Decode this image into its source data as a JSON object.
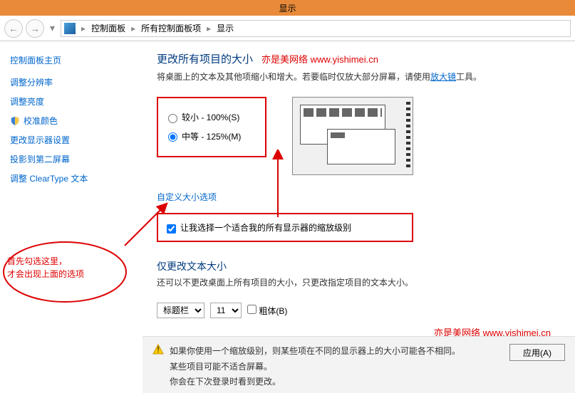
{
  "window": {
    "title": "显示"
  },
  "breadcrumb": {
    "items": [
      "控制面板",
      "所有控制面板项",
      "显示"
    ]
  },
  "sidebar": {
    "title": "控制面板主页",
    "links": [
      "调整分辨率",
      "调整亮度",
      "校准颜色",
      "更改显示器设置",
      "投影到第二屏幕",
      "调整 ClearType 文本"
    ]
  },
  "content": {
    "heading": "更改所有项目的大小",
    "watermark": "亦是美网络 www.yishimei.cn",
    "desc_pre": "将桌面上的文本及其他项缩小和增大。若要临时仅放大部分屏幕，请使用",
    "desc_link": "放大镜",
    "desc_post": "工具。",
    "radio": {
      "opt1": "较小 - 100%(S)",
      "opt2": "中等 - 125%(M)"
    },
    "custom_link": "自定义大小选项",
    "checkbox_label": "让我选择一个适合我的所有显示器的缩放级别",
    "sub_heading": "仅更改文本大小",
    "sub_desc": "还可以不更改桌面上所有项目的大小，只更改指定项目的文本大小。",
    "select1": "标题栏",
    "select2": "11",
    "bold_label": "粗体(B)",
    "watermark2": "亦是美网络  www.yishimei.cn",
    "warn_l1": "如果你使用一个缩放级别，则某些项在不同的显示器上的大小可能各不相同。",
    "warn_l2": "某些项目可能不适合屏幕。",
    "warn_l3": "你会在下次登录时看到更改。",
    "apply": "应用(A)"
  },
  "annotation": {
    "line1": "首先勾选这里，",
    "line2": "才会出现上面的选项"
  }
}
